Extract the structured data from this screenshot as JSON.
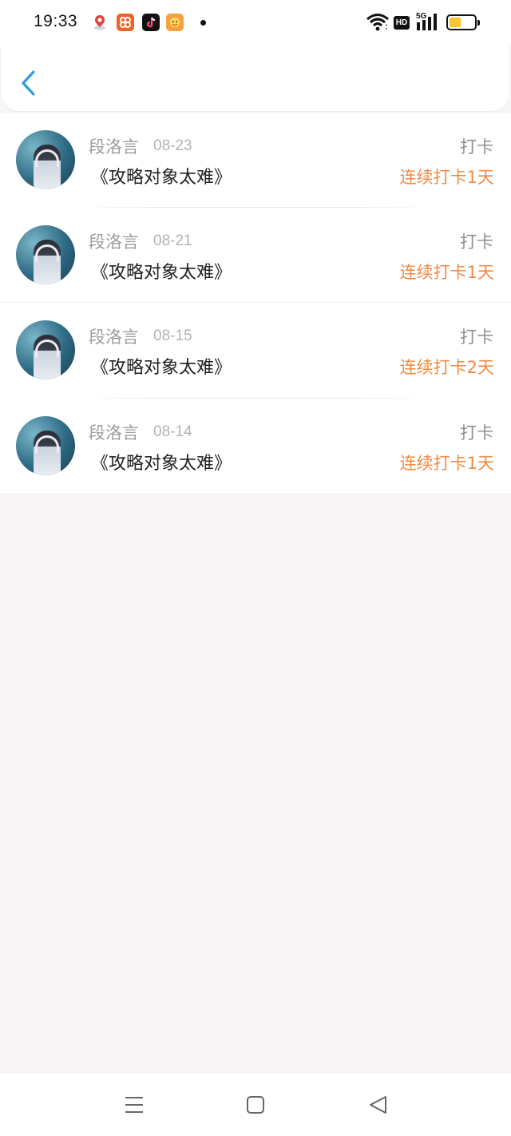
{
  "status_bar": {
    "time": "19:33",
    "hd_label": "HD",
    "network_label": "5G",
    "battery_level": 0.45,
    "notification_icons": [
      "map-pin-icon",
      "kuaikan-app-icon",
      "tiktok-app-icon",
      "game-app-icon"
    ]
  },
  "header": {
    "back_icon": "chevron-left-icon",
    "accent_color": "#2f9be0"
  },
  "records": [
    {
      "name": "段洛言",
      "date": "08-23",
      "book": "《攻略对象太难》",
      "action": "打卡",
      "streak": "连续打卡1天"
    },
    {
      "name": "段洛言",
      "date": "08-21",
      "book": "《攻略对象太难》",
      "action": "打卡",
      "streak": "连续打卡1天"
    },
    {
      "name": "段洛言",
      "date": "08-15",
      "book": "《攻略对象太难》",
      "action": "打卡",
      "streak": "连续打卡2天"
    },
    {
      "name": "段洛言",
      "date": "08-14",
      "book": "《攻略对象太难》",
      "action": "打卡",
      "streak": "连续打卡1天"
    }
  ],
  "colors": {
    "streak": "#f08a46",
    "background": "#f8f6f7"
  },
  "navbar": {
    "buttons": [
      "menu-icon",
      "home-square-icon",
      "back-triangle-icon"
    ]
  }
}
